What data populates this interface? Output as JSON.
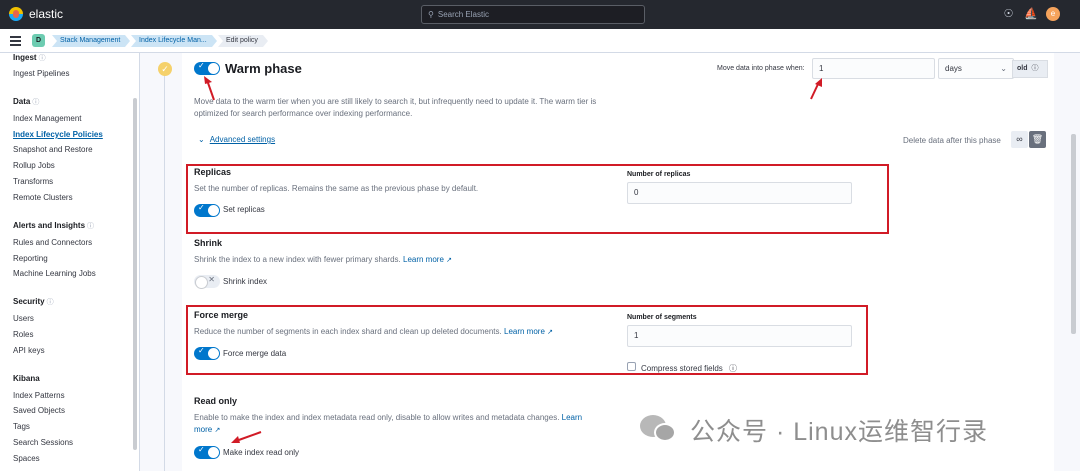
{
  "header": {
    "brand": "elastic",
    "search_placeholder": "Search Elastic",
    "user_initial": "e"
  },
  "breadcrumbs": {
    "space_initial": "D",
    "items": [
      "Stack Management",
      "Index Lifecycle Man...",
      "Edit policy"
    ]
  },
  "sidebar": {
    "groups": [
      {
        "title": "Ingest",
        "items": [
          "Ingest Pipelines"
        ]
      },
      {
        "title": "Data",
        "items": [
          "Index Management",
          "Index Lifecycle Policies",
          "Snapshot and Restore",
          "Rollup Jobs",
          "Transforms",
          "Remote Clusters"
        ]
      },
      {
        "title": "Alerts and Insights",
        "items": [
          "Rules and Connectors",
          "Reporting",
          "Machine Learning Jobs"
        ]
      },
      {
        "title": "Security",
        "items": [
          "Users",
          "Roles",
          "API keys"
        ]
      },
      {
        "title": "Kibana",
        "items": [
          "Index Patterns",
          "Saved Objects",
          "Tags",
          "Search Sessions",
          "Spaces"
        ]
      }
    ],
    "active_item": "Index Lifecycle Policies"
  },
  "warm_phase": {
    "title": "Warm phase",
    "enabled": true,
    "move_label": "Move data into phase when:",
    "move_value": "1",
    "unit": "days",
    "unit_suffix": "old",
    "description_1": "Move data to the warm tier when you are still likely to search it, but infrequently need to update it. The warm tier is",
    "description_2": "optimized for search performance over indexing performance.",
    "advanced_label": "Advanced settings",
    "delete_after_label": "Delete data after this phase"
  },
  "replicas": {
    "title": "Replicas",
    "description": "Set the number of replicas. Remains the same as the previous phase by default.",
    "toggle_label": "Set replicas",
    "field_label": "Number of replicas",
    "value": "0"
  },
  "shrink": {
    "title": "Shrink",
    "description": "Shrink the index to a new index with fewer primary shards.",
    "learn_more": "Learn more",
    "toggle_label": "Shrink index"
  },
  "force_merge": {
    "title": "Force merge",
    "description": "Reduce the number of segments in each index shard and clean up deleted documents.",
    "learn_more": "Learn more",
    "toggle_label": "Force merge data",
    "field_label": "Number of segments",
    "value": "1",
    "compress_label": "Compress stored fields"
  },
  "read_only": {
    "title": "Read only",
    "description_1": "Enable to make the index and index metadata read only, disable to allow writes and metadata changes.",
    "learn_more_1": "Learn",
    "learn_more_2": "more",
    "toggle_label": "Make index read only"
  },
  "watermark": {
    "text": "公众号 · Linux运维智行录"
  },
  "colors": {
    "accent": "#0077cc",
    "annotation": "#d11b26",
    "header_bg": "#25282f"
  }
}
